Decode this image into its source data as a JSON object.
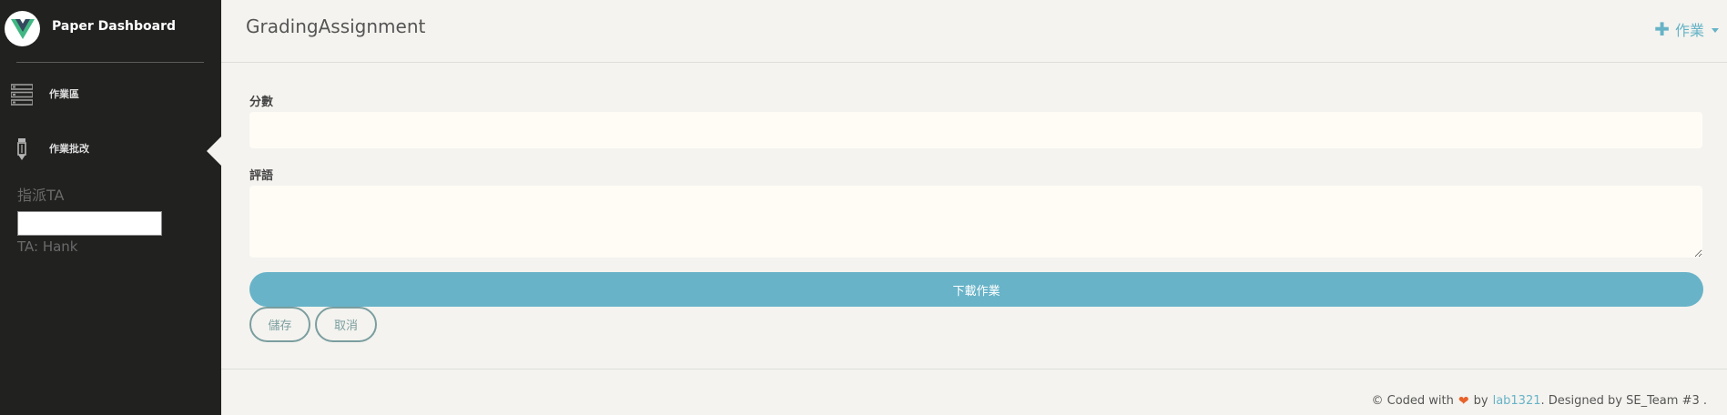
{
  "sidebar": {
    "brand": {
      "name": "Paper Dashboard",
      "logo_icon": "vue-logo-icon"
    },
    "items": [
      {
        "label": "作業區",
        "icon": "server-icon"
      },
      {
        "label": "作業批改",
        "icon": "pencil-icon"
      }
    ],
    "assign_label": "指派TA",
    "assign_input_value": "",
    "ta_text": "TA: Hank"
  },
  "topbar": {
    "title": "GradingAssignment",
    "add_menu_label": "作業"
  },
  "form": {
    "score_label": "分數",
    "score_value": "",
    "comment_label": "評語",
    "comment_value": "",
    "download_label": "下載作業",
    "save_label": "儲存",
    "cancel_label": "取消"
  },
  "footer": {
    "prefix": "© Coded with",
    "by": "by",
    "link": "lab1321",
    "suffix": ". Designed by SE_Team #3 ."
  },
  "colors": {
    "sidebar_bg": "#212120",
    "page_bg": "#f4f3ef",
    "accent": "#68b3c8",
    "outline": "#7a9e9f",
    "heart": "#e8622c"
  }
}
